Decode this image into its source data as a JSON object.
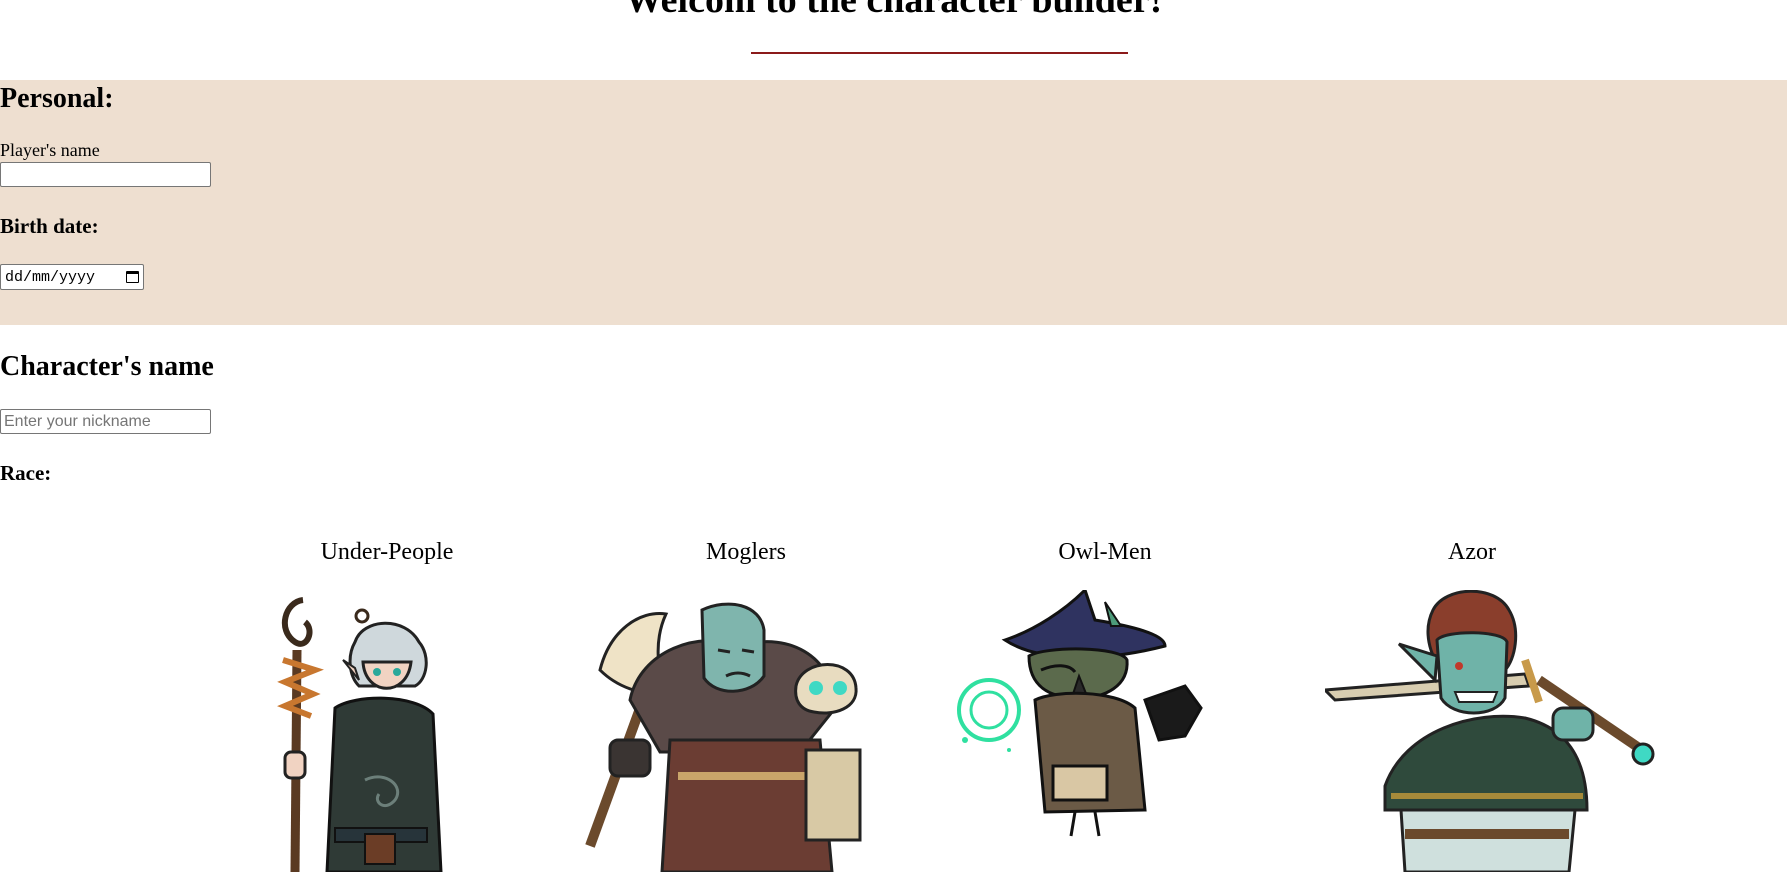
{
  "header": {
    "title": "Welcom to the character builder!"
  },
  "personal": {
    "heading": "Personal:",
    "player_name_label": "Player's name",
    "player_name_value": "",
    "birth_date_heading": "Birth date:",
    "birth_date_placeholder": "dd/mm/yyyy"
  },
  "character": {
    "heading": "Character's name",
    "nickname_placeholder": "Enter your nickname",
    "race_heading": "Race:"
  },
  "races": [
    {
      "name": "Under-People",
      "icon": "elf-staff-portrait"
    },
    {
      "name": "Moglers",
      "icon": "orc-axe-portrait"
    },
    {
      "name": "Owl-Men",
      "icon": "owl-wizard-portrait"
    },
    {
      "name": "Azor",
      "icon": "goblin-sword-portrait"
    }
  ],
  "colors": {
    "personal_background": "#eedfd0",
    "title_rule": "#8b1a1a"
  }
}
